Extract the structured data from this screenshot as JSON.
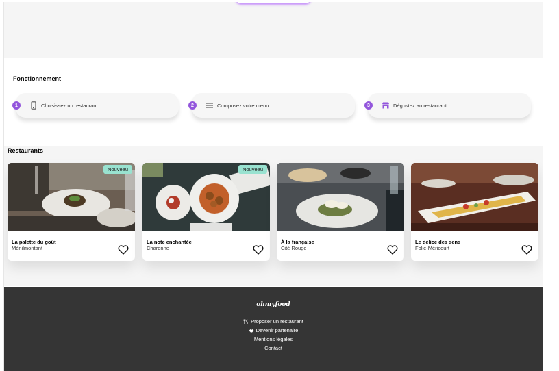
{
  "how": {
    "title": "Fonctionnement",
    "steps": [
      {
        "num": "1",
        "label": "Choisissez un restaurant",
        "icon": "mobile-phone-icon"
      },
      {
        "num": "2",
        "label": "Composez votre menu",
        "icon": "list-icon"
      },
      {
        "num": "3",
        "label": "Dégustez au restaurant",
        "icon": "store-icon"
      }
    ]
  },
  "restaurants": {
    "title": "Restaurants",
    "badge_label": "Nouveau",
    "items": [
      {
        "name": "La palette du goût",
        "location": "Ménilmontant",
        "badge": "Nouveau",
        "liked": false
      },
      {
        "name": "La note enchantée",
        "location": "Charonne",
        "badge": "Nouveau",
        "liked": false
      },
      {
        "name": "À la française",
        "location": "Cité Rouge",
        "badge": "",
        "liked": false
      },
      {
        "name": "Le délice des sens",
        "location": "Folie-Méricourt",
        "badge": "",
        "liked": false
      }
    ]
  },
  "footer": {
    "brand": "ohmyfood",
    "links": [
      {
        "label": "Proposer un restaurant",
        "icon": "utensils-icon"
      },
      {
        "label": "Devenir partenaire",
        "icon": "handshake-icon"
      },
      {
        "label": "Mentions légales",
        "icon": ""
      },
      {
        "label": "Contact",
        "icon": ""
      }
    ]
  },
  "colors": {
    "accent": "#9356dc",
    "badge": "#99e2d0",
    "footer_bg": "#353535",
    "section_bg": "#f5f5f5"
  }
}
